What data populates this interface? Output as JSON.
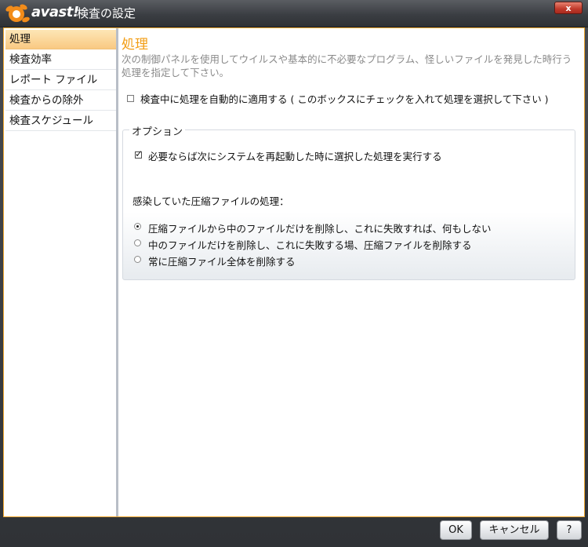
{
  "window": {
    "brand": "avast!",
    "title": "検査の設定",
    "close_label": "x"
  },
  "sidebar": {
    "items": [
      {
        "label": "処理",
        "selected": true
      },
      {
        "label": "検査効率",
        "selected": false
      },
      {
        "label": "レポート ファイル",
        "selected": false
      },
      {
        "label": "検査からの除外",
        "selected": false
      },
      {
        "label": "検査スケジュール",
        "selected": false
      }
    ]
  },
  "main": {
    "heading": "処理",
    "description": "次の制御パネルを使用してウイルスや基本的に不必要なプログラム、怪しいファイルを発見した時行う処理を指定して下さい。",
    "auto_apply": {
      "label": "検査中に処理を自動的に適用する ( このボックスにチェックを入れて処理を選択して下さい )",
      "checked": false
    },
    "options": {
      "legend": "オプション",
      "reboot_action": {
        "label": "必要ならば次にシステムを再起動した時に選択した処理を実行する",
        "checked": true
      },
      "archive_heading": "感染していた圧縮ファイルの処理：",
      "archive_choices": [
        {
          "label": "圧縮ファイルから中のファイルだけを削除し、これに失敗すれば、何もしない",
          "selected": true
        },
        {
          "label": "中のファイルだけを削除し、これに失敗する場、圧縮ファイルを削除する",
          "selected": false
        },
        {
          "label": "常に圧縮ファイル全体を削除する",
          "selected": false
        }
      ]
    }
  },
  "footer": {
    "ok_label": "OK",
    "cancel_label": "キャンセル",
    "help_label": "?"
  },
  "colors": {
    "accent": "#f29d14",
    "selection": "#f9c982",
    "panel_border": "#f0a830"
  }
}
